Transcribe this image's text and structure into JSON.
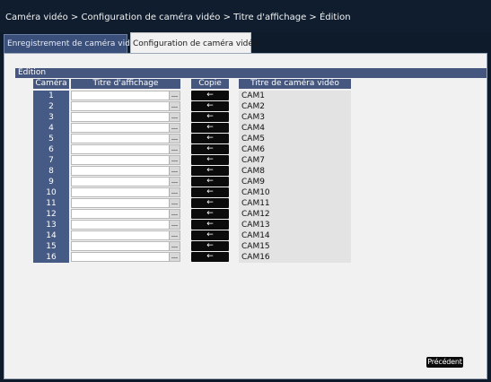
{
  "breadcrumb": "Caméra vidéo > Configuration de caméra vidéo > Titre d'affichage > Édition",
  "tabs": [
    {
      "label": "Enregistrement de caméra vidéo"
    },
    {
      "label": "Configuration de caméra vidéo"
    }
  ],
  "section_title": "Édition",
  "headers": {
    "camera": "Caméra",
    "display_title": "Titre d'affichage",
    "copy": "Copie",
    "camera_title": "Titre de caméra vidéo"
  },
  "rows": [
    {
      "num": "1",
      "title": "",
      "copy": "←",
      "cam": "CAM1"
    },
    {
      "num": "2",
      "title": "",
      "copy": "←",
      "cam": "CAM2"
    },
    {
      "num": "3",
      "title": "",
      "copy": "←",
      "cam": "CAM3"
    },
    {
      "num": "4",
      "title": "",
      "copy": "←",
      "cam": "CAM4"
    },
    {
      "num": "5",
      "title": "",
      "copy": "←",
      "cam": "CAM5"
    },
    {
      "num": "6",
      "title": "",
      "copy": "←",
      "cam": "CAM6"
    },
    {
      "num": "7",
      "title": "",
      "copy": "←",
      "cam": "CAM7"
    },
    {
      "num": "8",
      "title": "",
      "copy": "←",
      "cam": "CAM8"
    },
    {
      "num": "9",
      "title": "",
      "copy": "←",
      "cam": "CAM9"
    },
    {
      "num": "10",
      "title": "",
      "copy": "←",
      "cam": "CAM10"
    },
    {
      "num": "11",
      "title": "",
      "copy": "←",
      "cam": "CAM11"
    },
    {
      "num": "12",
      "title": "",
      "copy": "←",
      "cam": "CAM12"
    },
    {
      "num": "13",
      "title": "",
      "copy": "←",
      "cam": "CAM13"
    },
    {
      "num": "14",
      "title": "",
      "copy": "←",
      "cam": "CAM14"
    },
    {
      "num": "15",
      "title": "",
      "copy": "←",
      "cam": "CAM15"
    },
    {
      "num": "16",
      "title": "",
      "copy": "←",
      "cam": "CAM16"
    }
  ],
  "footer": {
    "previous_label": "Précédent"
  }
}
